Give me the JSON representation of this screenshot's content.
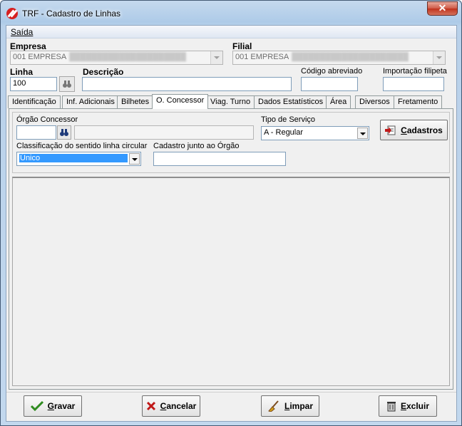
{
  "window": {
    "title": "TRF - Cadastro de Linhas",
    "close_glyph": "✕"
  },
  "menu": {
    "items": [
      {
        "label": "Saída"
      }
    ]
  },
  "header": {
    "empresa_label": "Empresa",
    "empresa_value": "001 EMPRESA",
    "filial_label": "Filial",
    "filial_value": "001 EMPRESA",
    "linha_label": "Linha",
    "linha_value": "100",
    "descricao_label": "Descrição",
    "descricao_value": "",
    "codigo_abreviado_label": "Código abreviado",
    "codigo_abreviado_value": "",
    "importacao_label": "Importação filipeta",
    "importacao_value": ""
  },
  "tabs": [
    {
      "label": "Identificação"
    },
    {
      "label": "Inf. Adicionais"
    },
    {
      "label": "Bilhetes"
    },
    {
      "label": "O. Concessor",
      "active": true
    },
    {
      "label": "Viag. Turno"
    },
    {
      "label": "Dados Estatísticos"
    },
    {
      "label": "Área"
    },
    {
      "label": "Diversos"
    },
    {
      "label": "Fretamento"
    }
  ],
  "concessor": {
    "orgao_label": "Órgão Concessor",
    "orgao_code": "",
    "orgao_name": "",
    "tipo_servico_label": "Tipo de Serviço",
    "tipo_servico_value": "A - Regular",
    "cadastros_label": "Cadastros",
    "classificacao_label": "Classificação do sentido linha circular",
    "classificacao_value": "Único",
    "cadastro_orgao_label": "Cadastro junto ao Órgão",
    "cadastro_orgao_value": ""
  },
  "actions": {
    "gravar": "Gravar",
    "cancelar": "Cancelar",
    "limpar": "Limpar",
    "excluir": "Excluir"
  },
  "icons": {
    "app": "trf-logo-icon",
    "lookup": "binoculars-icon",
    "gravar": "checkmark-icon",
    "cancelar": "x-icon",
    "limpar": "broom-icon",
    "excluir": "trash-icon",
    "cadastros": "document-icon"
  },
  "colors": {
    "selection": "#3399ff",
    "check_green": "#2e8b1f",
    "cancel_red": "#c01818"
  }
}
